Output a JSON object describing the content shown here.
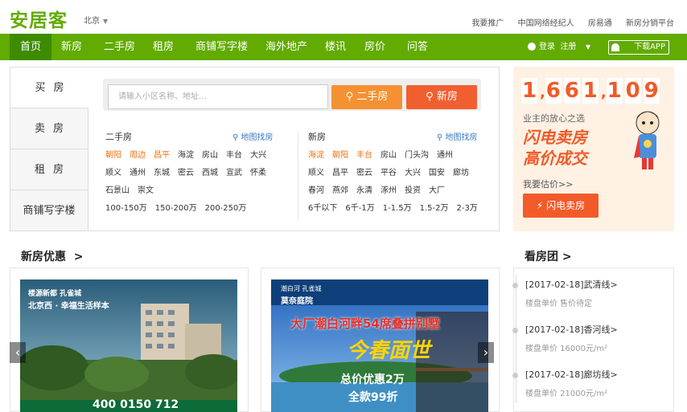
{
  "header": {
    "logo": "安居客",
    "city": "北京",
    "links": [
      "我要推广",
      "中国网络经纪人",
      "房易通",
      "新房分销平台"
    ]
  },
  "nav": {
    "items": [
      "首页",
      "新房",
      "二手房",
      "租房",
      "商铺写字楼",
      "海外地产",
      "楼讯",
      "房价",
      "问答"
    ],
    "login": "登录",
    "register": "注册",
    "app": "下载APP"
  },
  "search": {
    "tabs": [
      "买房",
      "卖房",
      "租房",
      "商铺写字楼"
    ],
    "placeholder": "请输入小区名称、地址...",
    "btn_ershou": "二手房",
    "btn_xinfang": "新房"
  },
  "quick": {
    "ershou": {
      "title": "二手房",
      "map": "地图找房",
      "rows": [
        [
          "朝阳",
          "周边",
          "昌平",
          "海淀",
          "房山",
          "丰台",
          "大兴"
        ],
        [
          "顺义",
          "通州",
          "东城",
          "密云",
          "西城",
          "宣武",
          "怀柔"
        ],
        [
          "石景山",
          "崇文"
        ],
        [
          "100-150万",
          "150-200万",
          "200-250万"
        ]
      ]
    },
    "xinfang": {
      "title": "新房",
      "map": "地图找房",
      "rows": [
        [
          "海淀",
          "朝阳",
          "丰台",
          "房山",
          "门头沟",
          "通州"
        ],
        [
          "顺义",
          "昌平",
          "密云",
          "平谷",
          "大兴",
          "国安",
          "廊坊"
        ],
        [
          "春河",
          "燕郊",
          "永清",
          "涿州",
          "投资",
          "大厂"
        ],
        [
          "6千以下",
          "6千-1万",
          "1-1.5万",
          "1.5-2万",
          "2-3万"
        ]
      ]
    }
  },
  "ad": {
    "number": [
      "1",
      "6",
      "6",
      "1",
      "1",
      "0",
      "9"
    ],
    "line1": "业主的放心之选",
    "line2": "闪电卖房",
    "line3": "高价成交",
    "line4": "我要估价>>",
    "button": "闪电卖房"
  },
  "sections": {
    "newhouse": "新房优惠",
    "kanfang": "看房团"
  },
  "cards": [
    {
      "tag1": "楼源新都 孔雀城",
      "tag2": "北京西 · 幸福生活样本",
      "phone": "400 0150 712"
    },
    {
      "tag1": "潮白河 孔雀城",
      "tag2": "莫奈庭院",
      "headline": "大厂潮白河畔54席叠拼别墅",
      "big": "今春面世",
      "price1": "总价优惠2万",
      "price2": "全款99折"
    }
  ],
  "kanfangtuan": [
    {
      "title": "[2017-02-18]武清线>",
      "sub": "楼盘单价 售价待定"
    },
    {
      "title": "[2017-02-18]香河线>",
      "sub": "楼盘单价 16000元/m²"
    },
    {
      "title": "[2017-02-18]廊坊线>",
      "sub": "楼盘单价 21000元/m²"
    }
  ],
  "colors": {
    "brand": "#62ab00",
    "orange": "#f49133",
    "red": "#f15f31"
  }
}
